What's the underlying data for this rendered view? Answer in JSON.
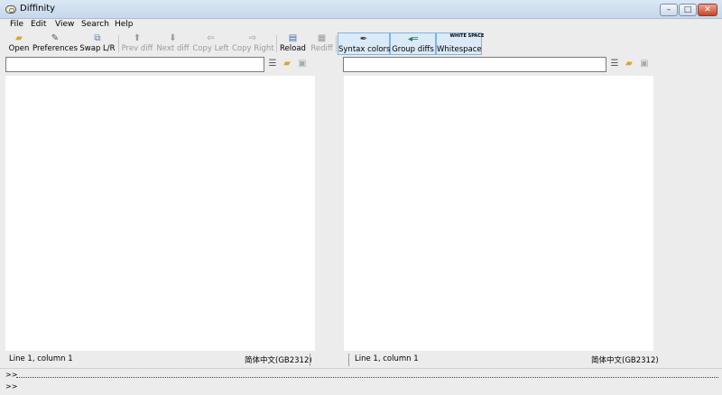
{
  "window": {
    "title": "Diffinity",
    "min_label": "–",
    "max_label": "□",
    "close_label": "✕"
  },
  "menu": [
    "File",
    "Edit",
    "View",
    "Search",
    "Help"
  ],
  "toolbar": {
    "open": "Open",
    "preferences": "Preferences",
    "swap": "Swap L/R",
    "prev_diff": "Prev diff",
    "next_diff": "Next diff",
    "copy_left": "Copy Left",
    "copy_right": "Copy Right",
    "reload": "Reload",
    "rediff": "Rediff",
    "syntax_colors": "Syntax colors",
    "group_diffs": "Group diffs",
    "whitespace": "Whitespace",
    "whitespace_icon_text": "WHITE SPACE"
  },
  "left": {
    "path_value": "",
    "status_position": "Line 1, column 1",
    "status_encoding": "简体中文(GB2312)"
  },
  "right": {
    "path_value": "",
    "status_position": "Line 1, column 1",
    "status_encoding": "简体中文(GB2312)"
  },
  "command": {
    "prompt1": ">>",
    "prompt2": ">>"
  }
}
